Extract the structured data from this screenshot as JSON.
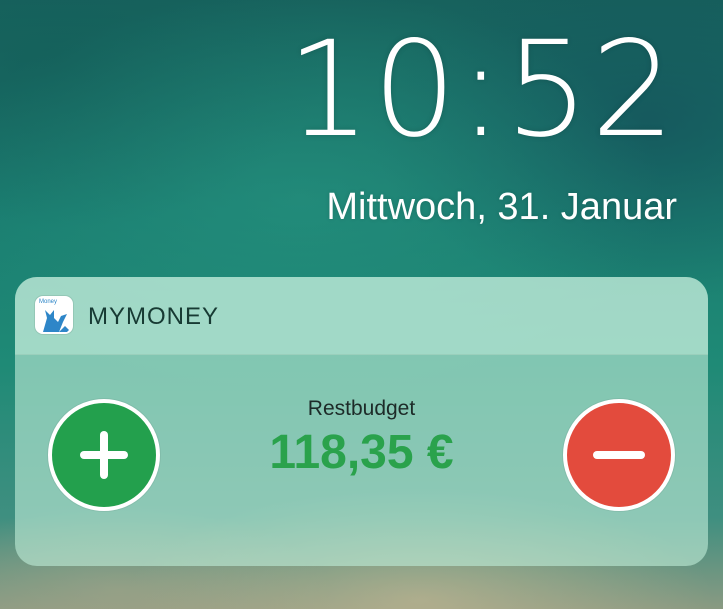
{
  "lockscreen": {
    "time": "10:52",
    "date": "Mittwoch, 31. Januar"
  },
  "widget": {
    "app_name": "MYMONEY",
    "app_icon": {
      "name": "mymoney-app-icon",
      "text": "Money",
      "color": "#2e86c8"
    },
    "budget_label": "Restbudget",
    "budget_value": "118,35 €",
    "add_button": {
      "icon": "plus-icon",
      "color": "#23a04d"
    },
    "subtract_button": {
      "icon": "minus-icon",
      "color": "#e34b3d"
    },
    "value_color": "#2aa24c"
  }
}
